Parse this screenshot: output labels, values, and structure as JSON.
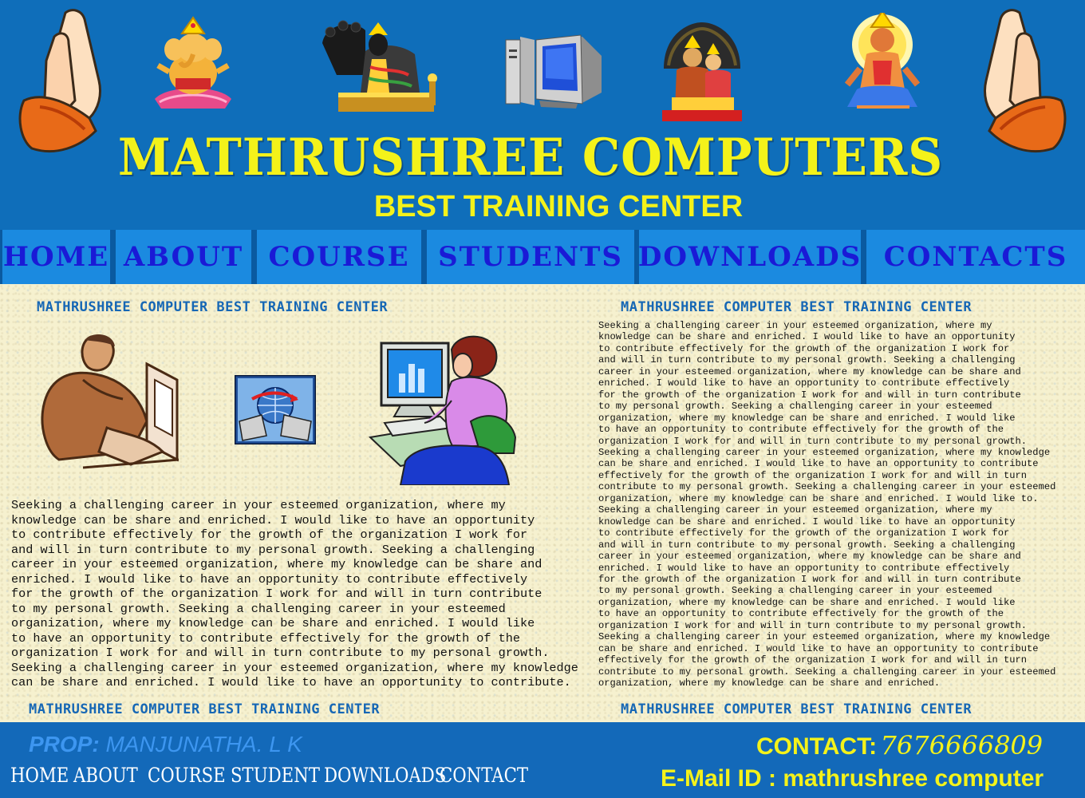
{
  "header": {
    "title": "MATHRUSHREE COMPUTERS",
    "subtitle": "BEST TRAINING CENTER"
  },
  "nav": {
    "items": [
      "HOME",
      "ABOUT",
      "COURSE",
      "STUDENTS",
      "DOWNLOADS",
      "CONTACTS"
    ]
  },
  "content": {
    "left_heading_top": "MATHRUSHREE COMPUTER BEST TRAINING CENTER",
    "right_heading_top": "MATHRUSHREE COMPUTER BEST TRAINING CENTER",
    "left_heading_bottom": "MATHRUSHREE COMPUTER BEST TRAINING CENTER",
    "right_heading_bottom": "MATHRUSHREE COMPUTER BEST TRAINING CENTER",
    "left_paragraph": "Seeking a challenging career in your esteemed organization, where my\nknowledge can be share and enriched. I would like to have an opportunity\nto contribute effectively for the growth of the organization I work for\nand will in turn contribute to my personal growth. Seeking a challenging\ncareer in your esteemed organization, where my knowledge can be share and\nenriched. I would like to have an opportunity to contribute effectively\nfor the growth of the organization I work for and will in turn contribute\nto my personal growth. Seeking a challenging career in your esteemed\norganization, where my knowledge can be share and enriched. I would like\nto have an opportunity to contribute effectively for the growth of the\norganization I work for and will in turn contribute to my personal growth.\nSeeking a challenging career in your esteemed organization, where my knowledge\ncan be share and enriched. I would like to have an opportunity to contribute.",
    "right_paragraph": "Seeking a challenging career in your esteemed organization, where my\nknowledge can be share and enriched. I would like to have an opportunity\nto contribute effectively for the growth of the organization I work for\nand will in turn contribute to my personal growth. Seeking a challenging\ncareer in your esteemed organization, where my knowledge can be share and\nenriched. I would like to have an opportunity to contribute effectively\nfor the growth of the organization I work for and will in turn contribute\nto my personal growth. Seeking a challenging career in your esteemed\norganization, where my knowledge can be share and enriched. I would like\nto have an opportunity to contribute effectively for the growth of the\norganization I work for and will in turn contribute to my personal growth.\nSeeking a challenging career in your esteemed organization, where my knowledge\ncan be share and enriched. I would like to have an opportunity to contribute\neffectively for the growth of the organization I work for and will in turn\ncontribute to my personal growth. Seeking a challenging career in your esteemed\norganization, where my knowledge can be share and enriched. I would like to.\nSeeking a challenging career in your esteemed organization, where my\nknowledge can be share and enriched. I would like to have an opportunity\nto contribute effectively for the growth of the organization I work for\nand will in turn contribute to my personal growth. Seeking a challenging\ncareer in your esteemed organization, where my knowledge can be share and\nenriched. I would like to have an opportunity to contribute effectively\nfor the growth of the organization I work for and will in turn contribute\nto my personal growth. Seeking a challenging career in your esteemed\norganization, where my knowledge can be share and enriched. I would like\nto have an opportunity to contribute effectively for the growth of the\norganization I work for and will in turn contribute to my personal growth.\nSeeking a challenging career in your esteemed organization, where my knowledge\ncan be share and enriched. I would like to have an opportunity to contribute\neffectively for the growth of the organization I work for and will in turn\ncontribute to my personal growth. Seeking a challenging career in your esteemed\norganization, where my knowledge can be share and enriched."
  },
  "footer": {
    "prop_label": "PROP:",
    "prop_name": "MANJUNATHA. L K",
    "nav": [
      "HOME",
      "ABOUT",
      "COURSE",
      "STUDENT",
      "DOWNLOADS",
      "CONTACT"
    ],
    "contact_label": "CONTACT:",
    "contact_phone": "7676666809",
    "email_line": "E-Mail ID : mathrushree computer"
  },
  "colors": {
    "header_bg": "#0f6eba",
    "title_yellow": "#f4f21a",
    "nav_button": "#1b8ae0",
    "nav_text": "#1a1ad6",
    "content_bg": "#f6f1cf",
    "heading_blue": "#1667b5"
  },
  "icons": [
    "praying-hands-icon",
    "ganesha-image",
    "deity-image",
    "computer-icon",
    "narasimha-image",
    "hanuman-image",
    "businessman-computer-clipart",
    "network-computers-clipart",
    "woman-computer-clipart"
  ]
}
